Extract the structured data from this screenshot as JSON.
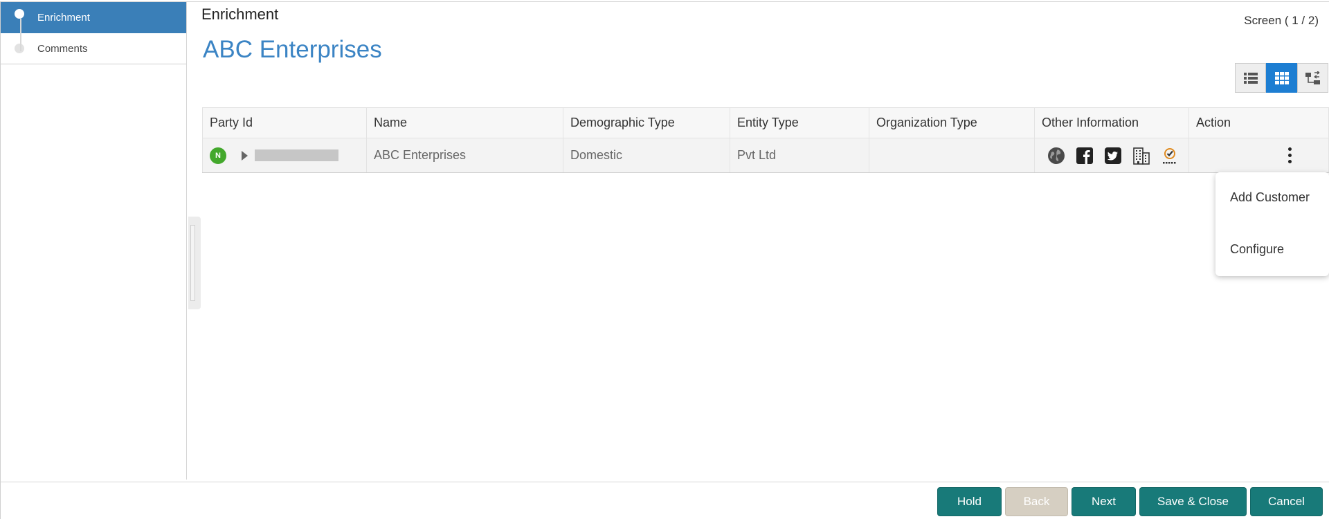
{
  "sidebar": {
    "steps": [
      {
        "label": "Enrichment",
        "state": "active"
      },
      {
        "label": "Comments",
        "state": "inactive"
      }
    ]
  },
  "header": {
    "section_title": "Enrichment",
    "screen_indicator": "Screen ( 1 / 2)",
    "page_title": "ABC Enterprises"
  },
  "view_toggles": [
    {
      "name": "list-view",
      "active": false
    },
    {
      "name": "grid-view",
      "active": true
    },
    {
      "name": "hierarchy-view",
      "active": false
    }
  ],
  "table": {
    "columns": [
      "Party Id",
      "Name",
      "Demographic Type",
      "Entity Type",
      "Organization Type",
      "Other Information",
      "Action"
    ],
    "rows": [
      {
        "badge": "N",
        "party_id": "",
        "name": "ABC Enterprises",
        "demographic_type": "Domestic",
        "entity_type": "Pvt Ltd",
        "organization_type": "",
        "other_information_icons": [
          "globe-icon",
          "facebook-icon",
          "twitter-icon",
          "building-icon",
          "checklist-icon"
        ]
      }
    ]
  },
  "action_menu": {
    "items": [
      "Add Customer",
      "Configure"
    ]
  },
  "footer": {
    "buttons": [
      {
        "label": "Hold",
        "enabled": true
      },
      {
        "label": "Back",
        "enabled": false
      },
      {
        "label": "Next",
        "enabled": true
      },
      {
        "label": "Save & Close",
        "enabled": true
      },
      {
        "label": "Cancel",
        "enabled": true
      }
    ]
  },
  "colors": {
    "active_step": "#3a7fb8",
    "page_title": "#3b84c4",
    "toggle_active": "#1d7ed2",
    "primary_button": "#187a79",
    "disabled_button": "#d6cfc2",
    "new_badge": "#43a82c"
  }
}
